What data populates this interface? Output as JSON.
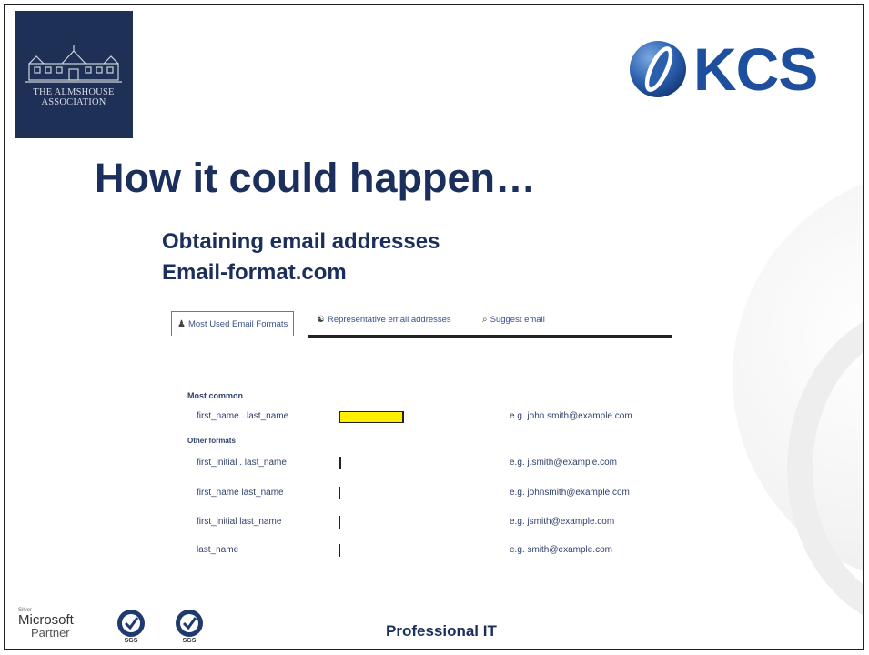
{
  "logos": {
    "almshouse_line1": "THE ALMSHOUSE",
    "almshouse_line2": "ASSOCIATION",
    "kcs": "KCS"
  },
  "slide": {
    "title": "How it could happen…",
    "subtitle_line1": "Obtaining email addresses",
    "subtitle_line2": "Email-format.com"
  },
  "screenshot": {
    "tabs": [
      {
        "label": "Most Used Email Formats"
      },
      {
        "label": "Representative email addresses"
      },
      {
        "label": "Suggest email"
      }
    ],
    "section_primary": "Most common",
    "section_other": "Other formats",
    "formats": [
      {
        "name": "first_name . last_name",
        "example": "e.g. john.smith@example.com",
        "highlighted": true
      },
      {
        "name": "first_initial . last_name",
        "example": "e.g. j.smith@example.com",
        "highlighted": false
      },
      {
        "name": "first_name last_name",
        "example": "e.g. johnsmith@example.com",
        "highlighted": false
      },
      {
        "name": "first_initial last_name",
        "example": "e.g. jsmith@example.com",
        "highlighted": false
      },
      {
        "name": "last_name",
        "example": "e.g. smith@example.com",
        "highlighted": false
      }
    ]
  },
  "footer": {
    "ms_small": "Silver",
    "ms_line1": "Microsoft",
    "ms_line2": "Partner",
    "sgs_label": "SGS",
    "tagline": "Professional IT"
  },
  "colors": {
    "navy": "#1b2f5c",
    "kcs_blue": "#1e4f9e",
    "highlight_yellow": "#ffee00"
  }
}
